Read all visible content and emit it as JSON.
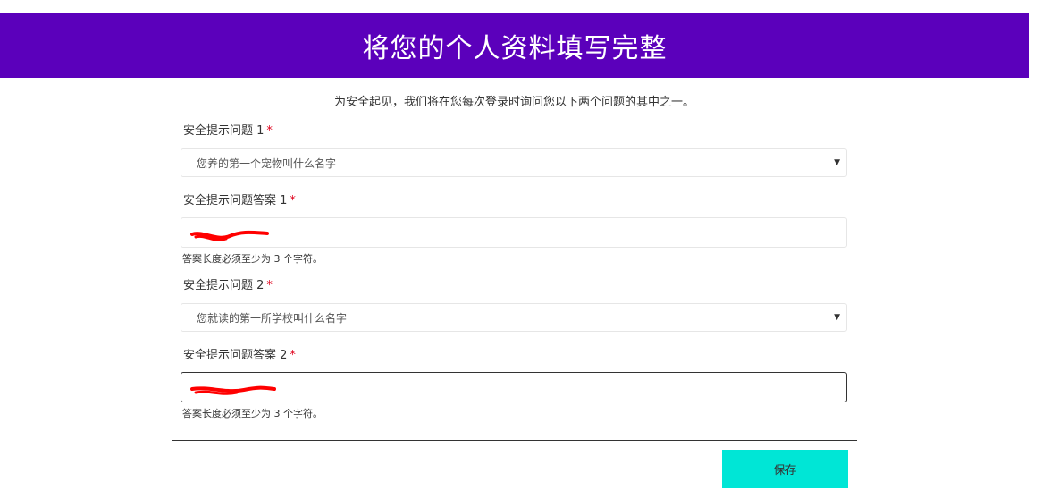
{
  "header": {
    "title": "将您的个人资料填写完整"
  },
  "intro": {
    "text": "为安全起见，我们将在您每次登录时询问您以下两个问题的其中之一。"
  },
  "form": {
    "question1": {
      "label": "安全提示问题 1",
      "required_mark": "*",
      "selected": "您养的第一个宠物叫什么名字",
      "icon": "caret-down-icon"
    },
    "answer1": {
      "label": "安全提示问题答案 1",
      "required_mark": "*",
      "hint": "答案长度必须至少为 3 个字符。"
    },
    "question2": {
      "label": "安全提示问题 2",
      "required_mark": "*",
      "selected": "您就读的第一所学校叫什么名字",
      "icon": "caret-down-icon"
    },
    "answer2": {
      "label": "安全提示问题答案 2",
      "required_mark": "*",
      "hint": "答案长度必须至少为 3 个字符。"
    }
  },
  "actions": {
    "save_label": "保存"
  },
  "colors": {
    "header_bg": "#5b00bb",
    "save_bg": "#00e6d6",
    "required": "#e0001b",
    "redaction": "#ff0000"
  }
}
